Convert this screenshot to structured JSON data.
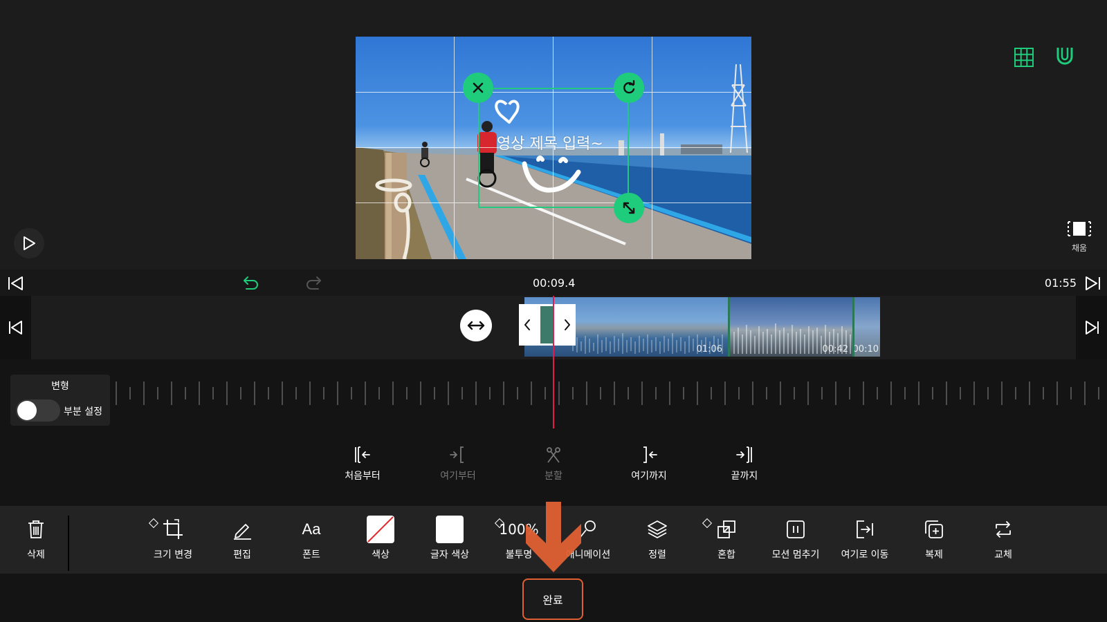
{
  "preview": {
    "title_text": "영상 제목 입력~",
    "fill_label": "채움"
  },
  "timebar": {
    "current_time": "00:09.4",
    "total_time": "01:55"
  },
  "clips": [
    {
      "duration": "01:06"
    },
    {
      "duration": "00:42"
    },
    {
      "duration": "00:10"
    }
  ],
  "transform_panel": {
    "title": "변형",
    "partial_label": "부분 설정",
    "toggle_on": false
  },
  "trim_actions": [
    {
      "label": "처음부터",
      "enabled": true
    },
    {
      "label": "여기부터",
      "enabled": false
    },
    {
      "label": "분할",
      "enabled": false
    },
    {
      "label": "여기까지",
      "enabled": true
    },
    {
      "label": "끝까지",
      "enabled": true
    }
  ],
  "toolbar": {
    "delete": "삭제",
    "resize": "크기 변경",
    "edit": "편집",
    "font": "폰트",
    "color": "색상",
    "text_color": "글자 색상",
    "opacity_value": "100%",
    "opacity": "불투명",
    "animation": "애니메이션",
    "align": "정렬",
    "blend": "혼합",
    "motion_stop": "모션 멈추기",
    "move_here": "여기로 이동",
    "duplicate": "복제",
    "replace": "교체"
  },
  "done_label": "완료",
  "colors": {
    "accent": "#1fcc7c",
    "playhead": "#e8194f",
    "highlight": "#e06034"
  }
}
